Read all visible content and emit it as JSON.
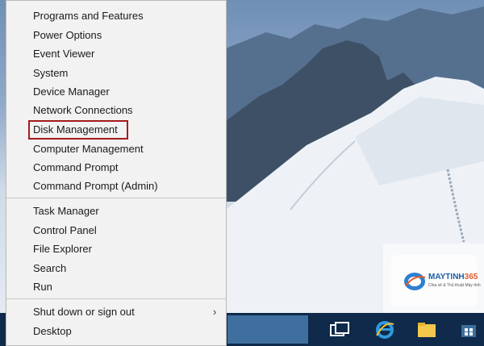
{
  "menu": {
    "items": [
      {
        "label": "Programs and Features"
      },
      {
        "label": "Power Options"
      },
      {
        "label": "Event Viewer"
      },
      {
        "label": "System"
      },
      {
        "label": "Device Manager"
      },
      {
        "label": "Network Connections"
      },
      {
        "label": "Disk Management"
      },
      {
        "label": "Computer Management"
      },
      {
        "label": "Command Prompt"
      },
      {
        "label": "Command Prompt (Admin)"
      },
      {
        "label": "Task Manager"
      },
      {
        "label": "Control Panel"
      },
      {
        "label": "File Explorer"
      },
      {
        "label": "Search"
      },
      {
        "label": "Run"
      },
      {
        "label": "Shut down or sign out",
        "submenu_icon": "chevron-right-icon"
      },
      {
        "label": "Desktop"
      }
    ],
    "highlighted_item": "Disk Management",
    "highlight_color": "#a31c1c"
  },
  "taskbar": {
    "icons": [
      "task-view-icon",
      "internet-explorer-icon",
      "file-explorer-icon",
      "store-icon"
    ]
  },
  "watermark": {
    "brand_main": "MAYTINH",
    "brand_accent": "365",
    "tagline": "Chia sẻ & Thủ thuật Máy tính",
    "icon": "maytinh365-logo-icon"
  }
}
